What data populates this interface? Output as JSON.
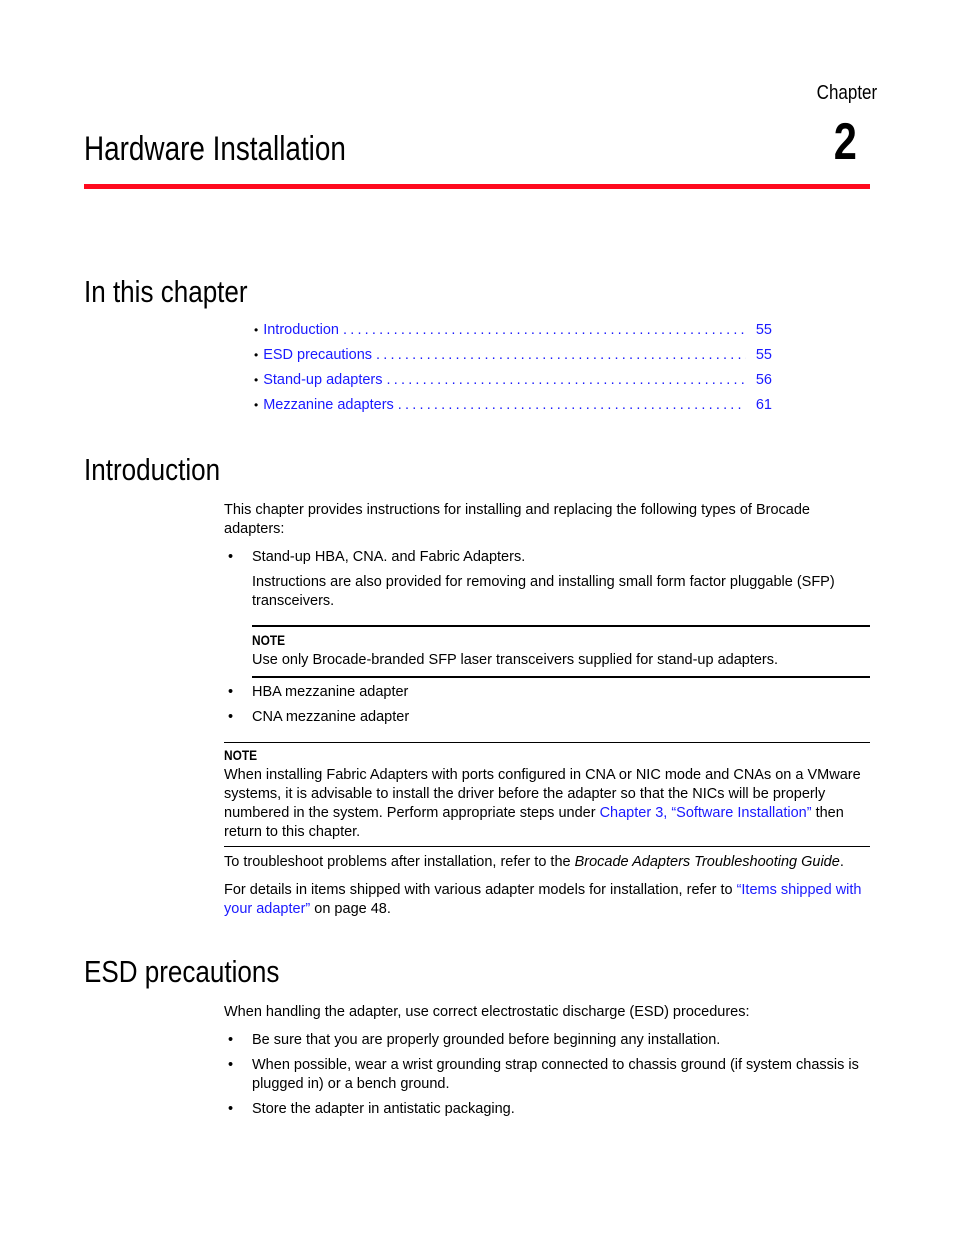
{
  "header": {
    "chapter_label": "Chapter",
    "chapter_number": "2",
    "chapter_title": "Hardware Installation",
    "rule_color": "#ff0a1e"
  },
  "in_this_chapter": {
    "heading": "In this chapter",
    "items": [
      {
        "label": "Introduction",
        "page": "55"
      },
      {
        "label": "ESD precautions",
        "page": "55"
      },
      {
        "label": "Stand-up adapters",
        "page": "56"
      },
      {
        "label": "Mezzanine adapters",
        "page": "61"
      }
    ],
    "dots": "............................................................................................"
  },
  "introduction": {
    "heading": "Introduction",
    "intro": "This chapter provides instructions for installing and replacing the following types of Brocade adapters:",
    "bullets": [
      "Stand-up HBA, CNA. and Fabric Adapters.",
      "HBA mezzanine adapter",
      "CNA mezzanine adapter"
    ],
    "sub_paragraph": "Instructions are also provided for removing and installing small form factor pluggable (SFP) transceivers.",
    "note1": {
      "label": "NOTE",
      "text": "Use only Brocade-branded SFP laser transceivers supplied for stand-up adapters."
    },
    "note2": {
      "label": "NOTE",
      "text_before": "When installing Fabric Adapters with ports configured in CNA or NIC mode and CNAs on a VMware systems, it is advisable to install the driver before the adapter so that the NICs will be properly numbered in the system. Perform appropriate steps under ",
      "link": "Chapter 3, “Software Installation”",
      "text_after": " then return to this chapter."
    },
    "troubleshoot_before": "To troubleshoot problems after installation, refer to the ",
    "troubleshoot_guide": "Brocade Adapters Troubleshooting Guide",
    "troubleshoot_after": ".",
    "details_before": "For details in items shipped with various adapter models for installation, refer to ",
    "details_link": "“Items shipped with your adapter”",
    "details_after": " on page 48."
  },
  "esd": {
    "heading": "ESD precautions",
    "intro": "When handling the adapter, use correct electrostatic discharge (ESD) procedures:",
    "bullets": [
      "Be sure that you are properly grounded before beginning any installation.",
      "When possible, wear a wrist grounding strap connected to chassis ground (if system chassis is plugged in) or a bench ground.",
      "Store the adapter in antistatic packaging."
    ]
  },
  "bullet_glyph": "•"
}
